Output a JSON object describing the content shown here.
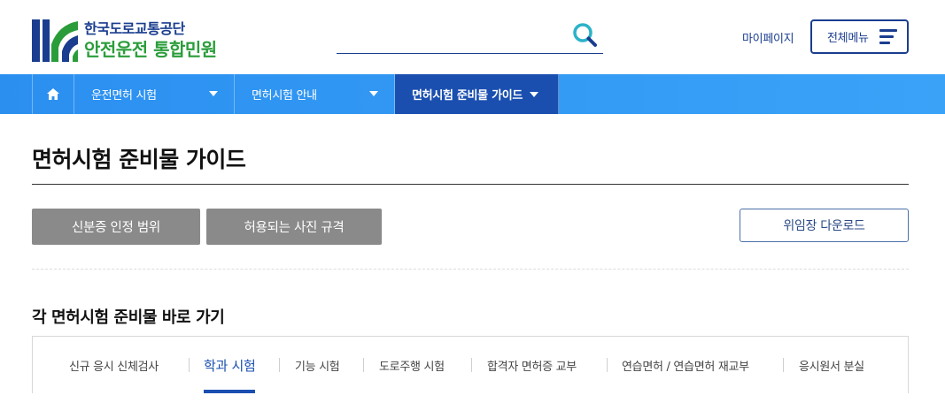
{
  "header": {
    "logo_line1": "한국도로교통공단",
    "logo_line2": "안전운전 통합민원",
    "search": {
      "placeholder": "",
      "value": ""
    },
    "mypage_label": "마이페이지",
    "allmenu_label": "전체메뉴"
  },
  "nav": {
    "items": [
      {
        "label": "운전면허 시험",
        "active": false
      },
      {
        "label": "면허시험 안내",
        "active": false
      },
      {
        "label": "면허시험 준비물 가이드",
        "active": true
      }
    ]
  },
  "main": {
    "title": "면허시험 준비물 가이드",
    "buttons": {
      "id_scope": "신분증 인정 범위",
      "photo_spec": "허용되는 사진 규격",
      "proxy_download": "위임장 다운로드"
    },
    "section_title": "각 면허시험 준비물 바로 가기",
    "tabs": [
      {
        "label": "신규 응시 신체검사",
        "active": false
      },
      {
        "label": "학과 시험",
        "active": true
      },
      {
        "label": "기능 시험",
        "active": false
      },
      {
        "label": "도로주행 시험",
        "active": false
      },
      {
        "label": "합격자 면허증 교부",
        "active": false
      },
      {
        "label": "연습면허 / 연습면허 재교부",
        "active": false
      },
      {
        "label": "응시원서 분실",
        "active": false
      }
    ]
  },
  "colors": {
    "brand_navy": "#1a3d8f",
    "brand_green": "#2a9d3a",
    "nav_blue": "#3aa3f8",
    "nav_active": "#1a4fb0",
    "gray_button": "#8a8a8a"
  },
  "icons": {
    "home": "home-icon",
    "search": "search-icon",
    "menu": "hamburger-menu-icon",
    "caret": "caret-down-icon"
  }
}
